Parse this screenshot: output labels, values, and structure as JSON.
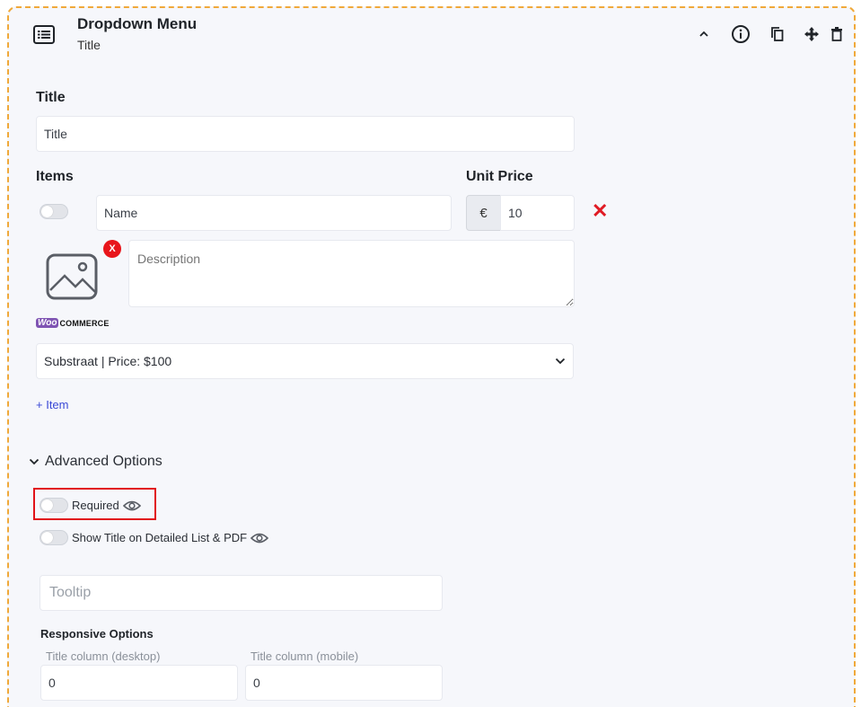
{
  "header": {
    "title": "Dropdown Menu",
    "subtitle": "Title",
    "icons": [
      "list-icon",
      "chevron-up-icon",
      "info-icon",
      "copy-icon",
      "move-icon",
      "trash-icon"
    ]
  },
  "title_section": {
    "label": "Title",
    "value": "Title"
  },
  "items_section": {
    "items_label": "Items",
    "unit_price_label": "Unit Price",
    "name_placeholder": "Name",
    "currency_symbol": "€",
    "price_value": "10",
    "delete_symbol": "✕",
    "image_remove_label": "X",
    "description_placeholder": "Description",
    "woo_logo": "Woo",
    "woo_text": "COMMERCE",
    "product_select": "Substraat | Price: $100",
    "add_item_label": "+ Item"
  },
  "advanced": {
    "label": "Advanced Options",
    "required_label": "Required",
    "show_title_label": "Show Title on Detailed List & PDF",
    "tooltip_placeholder": "Tooltip",
    "responsive_label": "Responsive Options",
    "desktop_label": "Title column (desktop)",
    "mobile_label": "Title column (mobile)",
    "desktop_value": "0",
    "mobile_value": "0"
  },
  "colors": {
    "panel_border": "#f0a93a",
    "panel_bg": "#f6f7fb",
    "accent_link": "#3b49d6",
    "danger": "#e01b24",
    "woo_purple": "#7f54b3"
  }
}
